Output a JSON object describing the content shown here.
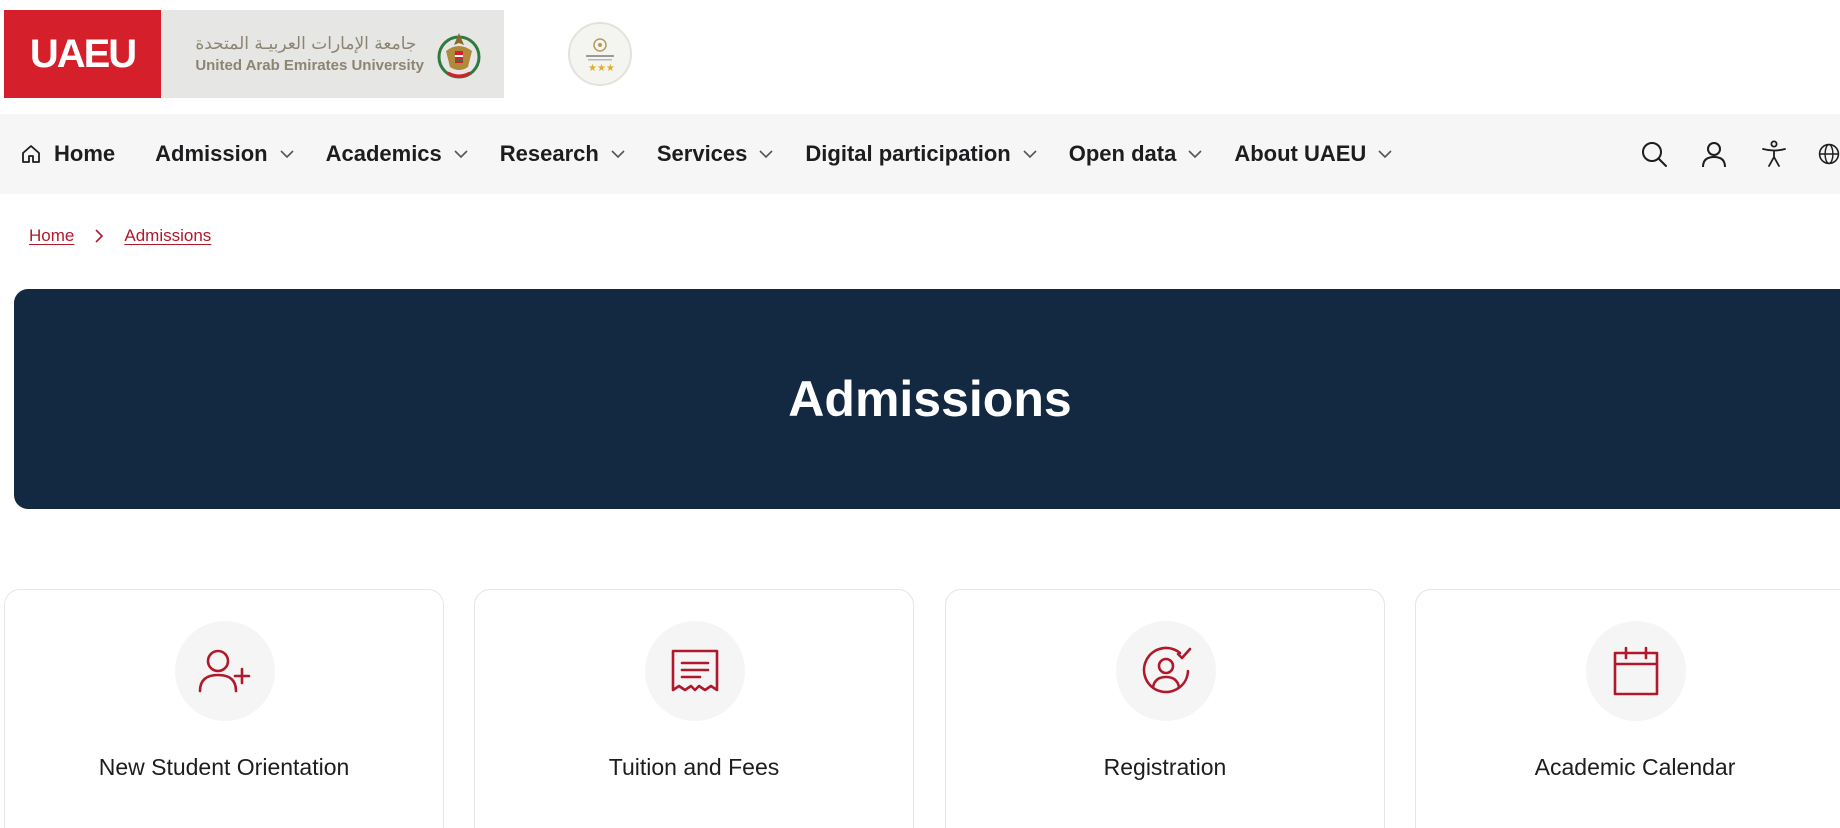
{
  "header": {
    "logo_short": "UAEU",
    "logo_arabic": "جامعة الإمارات العربيـة المتحدة",
    "logo_english": "United Arab Emirates University"
  },
  "nav": {
    "home": "Home",
    "items": [
      {
        "label": "Admission"
      },
      {
        "label": "Academics"
      },
      {
        "label": "Research"
      },
      {
        "label": "Services"
      },
      {
        "label": "Digital participation"
      },
      {
        "label": "Open data"
      },
      {
        "label": "About UAEU"
      }
    ],
    "tools": [
      "search-icon",
      "user-icon",
      "accessibility-icon",
      "globe-icon"
    ]
  },
  "breadcrumb": {
    "items": [
      "Home",
      "Admissions"
    ]
  },
  "hero": {
    "title": "Admissions"
  },
  "cards": [
    {
      "label": "New Student Orientation",
      "icon": "user-add-icon"
    },
    {
      "label": "Tuition and Fees",
      "icon": "receipt-icon"
    },
    {
      "label": "Registration",
      "icon": "user-check-icon"
    },
    {
      "label": "Academic Calendar",
      "icon": "calendar-icon"
    }
  ],
  "colors": {
    "brand_red": "#d5202c",
    "accent_red": "#b0182b",
    "hero_navy": "#132841",
    "nav_bg": "#f6f6f6"
  }
}
